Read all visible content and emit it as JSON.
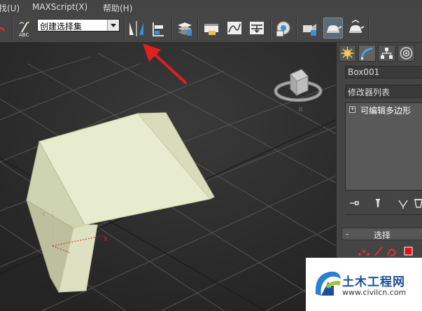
{
  "menubar": {
    "items": [
      {
        "label": "找(U)"
      },
      {
        "label": "MAXScript(X)"
      },
      {
        "label": "帮助(H)"
      }
    ]
  },
  "toolbar": {
    "selection_set": {
      "value": "创建选择集"
    },
    "tools": [
      "curve-icon",
      "edit-named-selection-icon",
      "mirror-icon",
      "align-icon",
      "layer-manager-icon",
      "scene-explorer-icon",
      "curve-editor-icon",
      "schematic-view-icon",
      "material-editor-icon",
      "render-setup-icon",
      "rendered-frame-window-icon",
      "render-icon",
      "render-iterative-icon"
    ],
    "active_tool": "render-icon"
  },
  "viewport": {
    "object_color": "#e0e4c4",
    "background": "#2b2b2b",
    "axis_y": "Y",
    "axis_x": "X",
    "viewcube": {
      "compass": "北"
    }
  },
  "command_panel": {
    "tabs": [
      "create-icon",
      "modify-icon",
      "hierarchy-icon",
      "motion-icon"
    ],
    "selected_tab": "modify-icon",
    "object_name": "Box001",
    "modifier_list": "修改器列表",
    "stack": [
      {
        "label": "可编辑多边形",
        "expand": "+"
      }
    ],
    "stack_buttons": [
      "pin-stack-icon",
      "show-end-result-icon",
      "make-unique-icon",
      "remove-modifier-icon"
    ],
    "rollout": {
      "toggle": "-",
      "title": "选择"
    },
    "subobject_icons": [
      "vertex-icon",
      "edge-icon",
      "border-icon",
      "polygon-icon"
    ]
  },
  "watermark": {
    "title": "土木工程网",
    "url": "www.civilcn.com"
  }
}
